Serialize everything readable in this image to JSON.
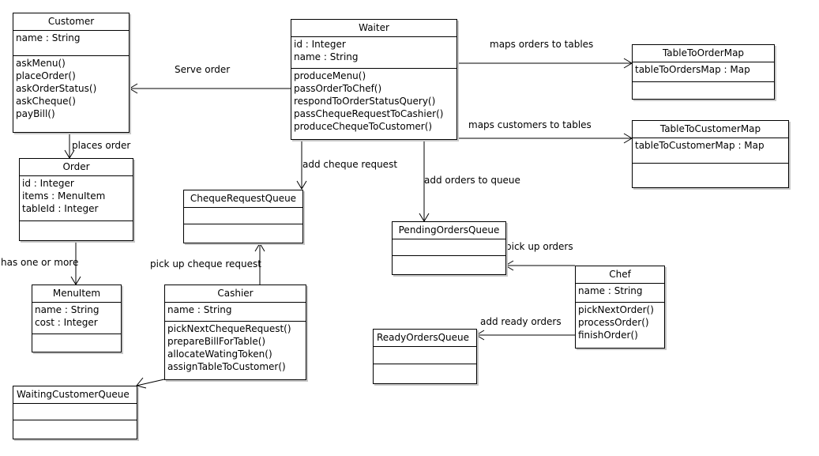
{
  "diagram": {
    "type": "UML class diagram",
    "classes": {
      "customer": {
        "name": "Customer",
        "attributes": [
          "name : String"
        ],
        "methods": [
          "askMenu()",
          "placeOrder()",
          "askOrderStatus()",
          "askCheque()",
          "payBill()"
        ]
      },
      "waiter": {
        "name": "Waiter",
        "attributes": [
          "id : Integer",
          "name : String"
        ],
        "methods": [
          "produceMenu()",
          "passOrderToChef()",
          "respondToOrderStatusQuery()",
          "passChequeRequestToCashier()",
          "produceChequeToCustomer()"
        ]
      },
      "table_to_order_map": {
        "name": "TableToOrderMap",
        "attributes": [
          "tableToOrdersMap : Map"
        ],
        "methods": []
      },
      "table_to_customer_map": {
        "name": "TableToCustomerMap",
        "attributes": [
          "tableToCustomerMap : Map"
        ],
        "methods": []
      },
      "order": {
        "name": "Order",
        "attributes": [
          "id : Integer",
          "items : MenuItem",
          "tableId : Integer"
        ],
        "methods": []
      },
      "menu_item": {
        "name": "MenuItem",
        "attributes": [
          "name : String",
          "cost : Integer"
        ],
        "methods": []
      },
      "cheque_request_queue": {
        "name": "ChequeRequestQueue",
        "attributes": [],
        "methods": []
      },
      "cashier": {
        "name": "Cashier",
        "attributes": [
          "name : String"
        ],
        "methods": [
          "pickNextChequeRequest()",
          "prepareBillForTable()",
          "allocateWatingToken()",
          "assignTableToCustomer()"
        ]
      },
      "waiting_customer_queue": {
        "name": "WaitingCustomerQueue",
        "attributes": [],
        "methods": []
      },
      "pending_orders_queue": {
        "name": "PendingOrdersQueue",
        "attributes": [],
        "methods": []
      },
      "ready_orders_queue": {
        "name": "ReadyOrdersQueue",
        "attributes": [],
        "methods": []
      },
      "chef": {
        "name": "Chef",
        "attributes": [
          "name : String"
        ],
        "methods": [
          "pickNextOrder()",
          "processOrder()",
          "finishOrder()"
        ]
      }
    },
    "relationships": [
      {
        "from": "Waiter",
        "to": "Customer",
        "label": "Serve order"
      },
      {
        "from": "Waiter",
        "to": "TableToOrderMap",
        "label": "maps orders to tables"
      },
      {
        "from": "Waiter",
        "to": "TableToCustomerMap",
        "label": "maps customers to tables"
      },
      {
        "from": "Customer",
        "to": "Order",
        "label": "places order"
      },
      {
        "from": "Order",
        "to": "MenuItem",
        "label": "has one or more"
      },
      {
        "from": "Waiter",
        "to": "ChequeRequestQueue",
        "label": "add cheque request"
      },
      {
        "from": "Waiter",
        "to": "PendingOrdersQueue",
        "label": "add orders to queue"
      },
      {
        "from": "Cashier",
        "to": "ChequeRequestQueue",
        "label": "pick up cheque request"
      },
      {
        "from": "Chef",
        "to": "PendingOrdersQueue",
        "label": "pick up orders"
      },
      {
        "from": "Chef",
        "to": "ReadyOrdersQueue",
        "label": "add ready orders"
      },
      {
        "from": "Cashier",
        "to": "WaitingCustomerQueue",
        "label": ""
      }
    ]
  }
}
